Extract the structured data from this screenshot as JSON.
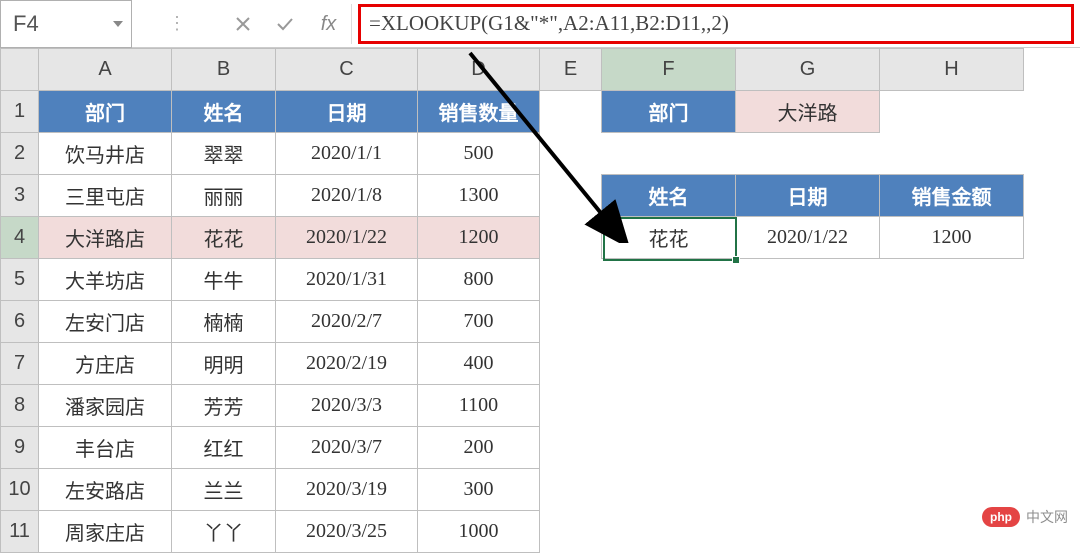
{
  "formula_bar": {
    "name_box": "F4",
    "fx_label": "fx",
    "formula": "=XLOOKUP(G1&\"*\",A2:A11,B2:D11,,2)"
  },
  "columns": [
    "A",
    "B",
    "C",
    "D",
    "E",
    "F",
    "G",
    "H"
  ],
  "row_headers": [
    1,
    2,
    3,
    4,
    5,
    6,
    7,
    8,
    9,
    10,
    11
  ],
  "main_table": {
    "headers": [
      "部门",
      "姓名",
      "日期",
      "销售数量"
    ],
    "rows": [
      {
        "dept": "饮马井店",
        "name": "翠翠",
        "date": "2020/1/1",
        "qty": 500
      },
      {
        "dept": "三里屯店",
        "name": "丽丽",
        "date": "2020/1/8",
        "qty": 1300
      },
      {
        "dept": "大洋路店",
        "name": "花花",
        "date": "2020/1/22",
        "qty": 1200
      },
      {
        "dept": "大羊坊店",
        "name": "牛牛",
        "date": "2020/1/31",
        "qty": 800
      },
      {
        "dept": "左安门店",
        "name": "楠楠",
        "date": "2020/2/7",
        "qty": 700
      },
      {
        "dept": "方庄店",
        "name": "明明",
        "date": "2020/2/19",
        "qty": 400
      },
      {
        "dept": "潘家园店",
        "name": "芳芳",
        "date": "2020/3/3",
        "qty": 1100
      },
      {
        "dept": "丰台店",
        "name": "红红",
        "date": "2020/3/7",
        "qty": 200
      },
      {
        "dept": "左安路店",
        "name": "兰兰",
        "date": "2020/3/19",
        "qty": 300
      },
      {
        "dept": "周家庄店",
        "name": "丫丫",
        "date": "2020/3/25",
        "qty": 1000
      }
    ],
    "highlight_row_index": 2
  },
  "lookup_block": {
    "label_dept": "部门",
    "value_dept": "大洋路",
    "headers": [
      "姓名",
      "日期",
      "销售金额"
    ],
    "result": {
      "name": "花花",
      "date": "2020/1/22",
      "amount": 1200
    }
  },
  "watermark": {
    "logo": "php",
    "text": "中文网"
  }
}
